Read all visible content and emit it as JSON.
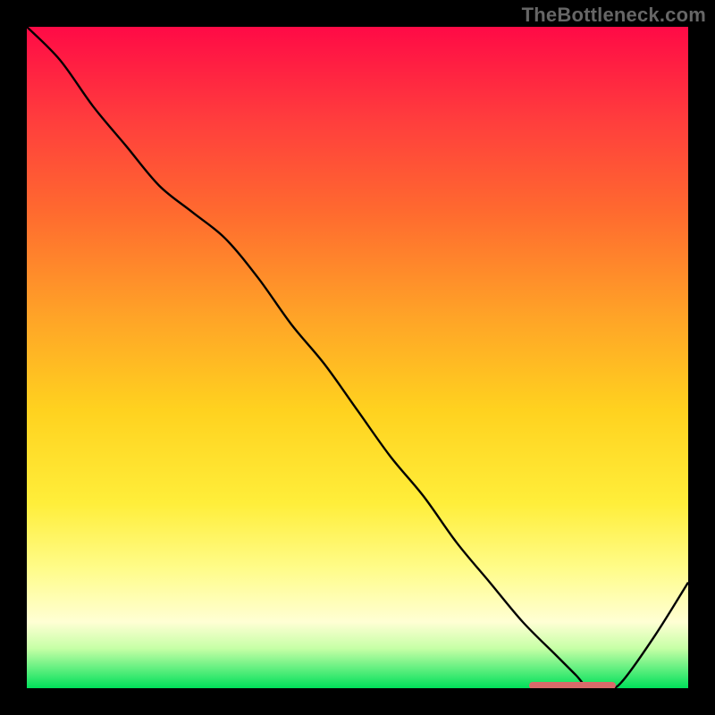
{
  "watermark": "TheBottleneck.com",
  "chart_data": {
    "type": "line",
    "title": "",
    "xlabel": "",
    "ylabel": "",
    "xlim": [
      0,
      100
    ],
    "ylim": [
      0,
      100
    ],
    "x": [
      0,
      5,
      10,
      15,
      20,
      25,
      30,
      35,
      40,
      45,
      50,
      55,
      60,
      65,
      70,
      75,
      80,
      83,
      85,
      88,
      90,
      95,
      100
    ],
    "values": [
      100,
      95,
      88,
      82,
      76,
      72,
      68,
      62,
      55,
      49,
      42,
      35,
      29,
      22,
      16,
      10,
      5,
      2,
      0,
      0,
      1,
      8,
      16
    ],
    "marker": {
      "x_start": 76,
      "x_end": 89,
      "y": 0.4
    },
    "gradient_stops": [
      {
        "pos": 0,
        "color": "#ff0a46"
      },
      {
        "pos": 14,
        "color": "#ff3d3d"
      },
      {
        "pos": 28,
        "color": "#ff6a2f"
      },
      {
        "pos": 44,
        "color": "#ffa427"
      },
      {
        "pos": 58,
        "color": "#ffd21f"
      },
      {
        "pos": 72,
        "color": "#ffee3a"
      },
      {
        "pos": 82,
        "color": "#fffc8a"
      },
      {
        "pos": 90,
        "color": "#ffffd4"
      },
      {
        "pos": 94,
        "color": "#c6ffa6"
      },
      {
        "pos": 100,
        "color": "#00e05a"
      }
    ]
  }
}
